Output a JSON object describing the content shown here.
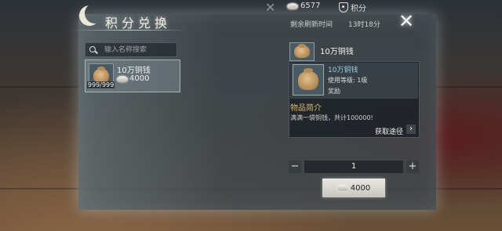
{
  "window": {
    "title": "积分兑换"
  },
  "currency": {
    "ingot_amount": "6577",
    "points_label": "积分"
  },
  "refresh": {
    "label": "剩余刷新时间",
    "time": "13时18分"
  },
  "search": {
    "placeholder": "输入名称搜索"
  },
  "items": [
    {
      "name": "10万铜钱",
      "stock": "999/999",
      "price": "4000"
    }
  ],
  "detail": {
    "title": "10万铜钱",
    "name": "10万铜钱",
    "level": "使用等级: 1级",
    "type": "奖励",
    "section": "物品简介",
    "description": "满满一袋铜钱，共计100000!",
    "source_label": "获取途径"
  },
  "quantity": {
    "value": "1",
    "minus": "−",
    "plus": "+"
  },
  "buy": {
    "price": "4000"
  },
  "icons": [
    "moon-icon",
    "ingot-icon",
    "shield-icon",
    "close-icon",
    "search-icon",
    "coin-bag-icon",
    "chevron-right-icon"
  ]
}
